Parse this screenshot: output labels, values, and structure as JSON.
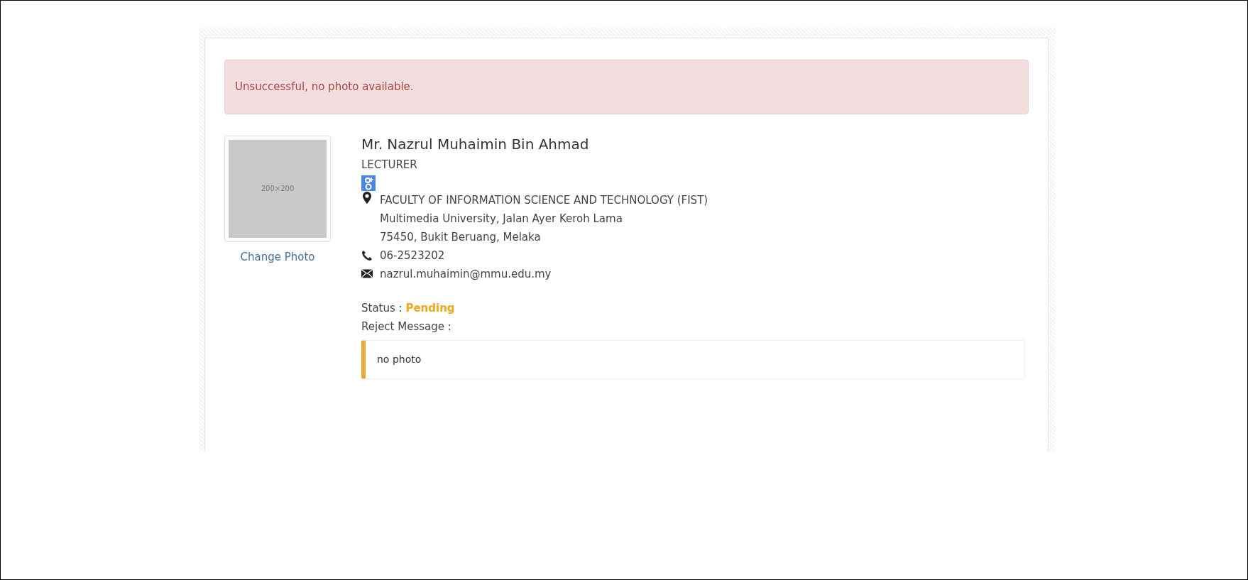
{
  "alert": {
    "message": "Unsuccessful, no photo available."
  },
  "photo": {
    "placeholder_label": "200×200",
    "change_link": "Change Photo"
  },
  "profile": {
    "name": "Mr. Nazrul Muhaimin Bin Ahmad",
    "position": "LECTURER",
    "address": [
      "FACULTY OF INFORMATION SCIENCE AND TECHNOLOGY (FIST)",
      "Multimedia University, Jalan Ayer Keroh Lama",
      "75450, Bukit Beruang, Melaka"
    ],
    "phone": "06-2523202",
    "email": "nazrul.muhaimin@mmu.edu.my"
  },
  "status": {
    "label": "Status :",
    "value": "Pending",
    "color": "#f0a818"
  },
  "reject": {
    "label": "Reject Message :",
    "message": "no photo"
  }
}
